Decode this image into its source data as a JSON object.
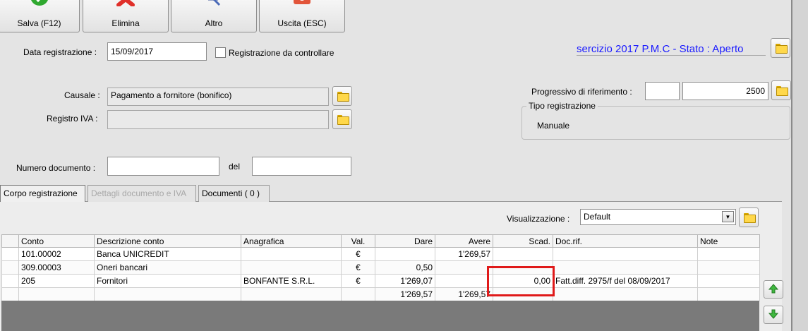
{
  "toolbar": {
    "save_label": "Salva (F12)",
    "delete_label": "Elimina",
    "other_label": "Altro",
    "exit_label": "Uscita (ESC)"
  },
  "form": {
    "data_registrazione_label": "Data registrazione :",
    "data_registrazione_value": "15/09/2017",
    "da_controllare_label": "Registrazione da controllare",
    "esercizio_status": "sercizio 2017 P.M.C - Stato : Aperto",
    "causale_label": "Causale :",
    "causale_value": "Pagamento a fornitore (bonifico)",
    "registro_iva_label": "Registro IVA :",
    "registro_iva_value": "",
    "progressivo_label": "Progressivo di riferimento :",
    "progressivo_prefix": "",
    "progressivo_value": "2500",
    "tipo_registrazione_title": "Tipo registrazione",
    "tipo_registrazione_value": "Manuale",
    "numero_documento_label": "Numero documento :",
    "numero_documento_value": "",
    "del_label": "del",
    "del_value": ""
  },
  "tabs": [
    "Corpo registrazione",
    "Dettagli documento e IVA",
    "Documenti ( 0 )"
  ],
  "visualizzazione": {
    "label": "Visualizzazione :",
    "value": "Default"
  },
  "grid": {
    "columns": [
      "Conto",
      "Descrizione conto",
      "Anagrafica",
      "Val.",
      "Dare",
      "Avere",
      "Scad.",
      "Doc.rif.",
      "Note"
    ],
    "rows": [
      [
        "101.00002",
        "Banca UNICREDIT",
        "",
        "€",
        "",
        "1'269,57",
        "",
        "",
        ""
      ],
      [
        "309.00003",
        "Oneri bancari",
        "",
        "€",
        "0,50",
        "",
        "",
        "",
        ""
      ],
      [
        "205",
        "Fornitori",
        "BONFANTE S.R.L.",
        "€",
        "1'269,07",
        "",
        "0,00",
        "Fatt.diff. 2975/f del 08/09/2017",
        ""
      ]
    ],
    "totals": [
      "",
      "",
      "",
      "",
      "1'269,57",
      "1'269,57",
      "",
      "",
      ""
    ]
  },
  "colors": {
    "status_blue": "#1a1aff",
    "highlight_red": "#e01a1a"
  }
}
